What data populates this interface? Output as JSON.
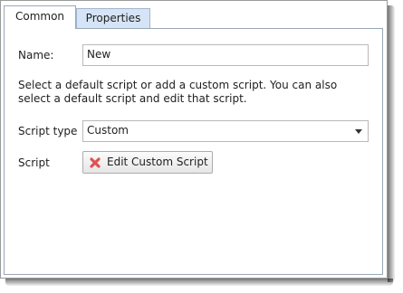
{
  "tabs": [
    {
      "label": "Common",
      "active": true
    },
    {
      "label": "Properties",
      "active": false
    }
  ],
  "form": {
    "name_label": "Name:",
    "name_value": "New",
    "description": "Select a default script or add a custom script. You can also select a default script and edit that script.",
    "script_type_label": "Script type",
    "script_type_value": "Custom",
    "script_label": "Script",
    "edit_button_label": "Edit Custom Script",
    "edit_button_icon": "red-x-icon"
  },
  "colors": {
    "accent_tab": "#d5e4f6",
    "icon_red": "#e05252"
  }
}
